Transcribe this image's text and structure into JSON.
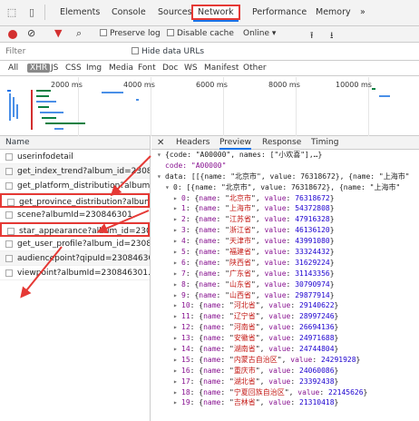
{
  "tabs": [
    "Elements",
    "Console",
    "Sources",
    "Network",
    "Performance",
    "Memory",
    "»"
  ],
  "active_tab": "Network",
  "toolbar": {
    "preserve_log": "Preserve log",
    "disable_cache": "Disable cache",
    "throttle": "Online"
  },
  "filter": {
    "placeholder": "Filter",
    "hide_data_urls": "Hide data URLs"
  },
  "types": [
    "All",
    "XHR",
    "JS",
    "CSS",
    "Img",
    "Media",
    "Font",
    "Doc",
    "WS",
    "Manifest",
    "Other"
  ],
  "active_type": "XHR",
  "overview_ticks": [
    "2000 ms",
    "4000 ms",
    "6000 ms",
    "8000 ms",
    "10000 ms"
  ],
  "requests_header": "Name",
  "requests": [
    "userinfodetail",
    "get_index_trend?album_id=2308...",
    "get_platform_distribution?album...",
    "get_province_distribution?album...",
    "scene?albumId=230846301",
    "star_appearance?album_id=2308...",
    "get_user_profile?album_id=2308...",
    "audiencepoint?qipuId=230846301",
    "viewpoint?albumId=230846301..."
  ],
  "highlighted_requests": [
    3,
    5
  ],
  "detail_tabs": [
    "Headers",
    "Preview",
    "Response",
    "Timing"
  ],
  "active_detail_tab": "Preview",
  "preview": {
    "root": "{code: \"A00000\", names: [\"小欢喜\"],…}",
    "code_line": "code: \"A00000\"",
    "data_line": "data: [[{name: \"北京市\", value: 76318672}, {name: \"上海市\"",
    "first_line": "0: [{name: \"北京市\", value: 76318672}, {name: \"上海市\"",
    "items": [
      {
        "index": "0",
        "name": "北京市",
        "value": "76318672"
      },
      {
        "index": "1",
        "name": "上海市",
        "value": "54372808"
      },
      {
        "index": "2",
        "name": "江苏省",
        "value": "47916328"
      },
      {
        "index": "3",
        "name": "浙江省",
        "value": "46136120"
      },
      {
        "index": "4",
        "name": "天津市",
        "value": "43991080"
      },
      {
        "index": "5",
        "name": "福建省",
        "value": "33324432"
      },
      {
        "index": "6",
        "name": "陕西省",
        "value": "31629224"
      },
      {
        "index": "7",
        "name": "广东省",
        "value": "31143356"
      },
      {
        "index": "8",
        "name": "山东省",
        "value": "30790974"
      },
      {
        "index": "9",
        "name": "山西省",
        "value": "29877914"
      },
      {
        "index": "10",
        "name": "河北省",
        "value": "29140622"
      },
      {
        "index": "11",
        "name": "辽宁省",
        "value": "28997246"
      },
      {
        "index": "12",
        "name": "河南省",
        "value": "26694136"
      },
      {
        "index": "13",
        "name": "安徽省",
        "value": "24971688"
      },
      {
        "index": "14",
        "name": "湖南省",
        "value": "24744804"
      },
      {
        "index": "15",
        "name": "内蒙古自治区",
        "value": "24291928"
      },
      {
        "index": "16",
        "name": "重庆市",
        "value": "24060086"
      },
      {
        "index": "17",
        "name": "湖北省",
        "value": "23392438"
      },
      {
        "index": "18",
        "name": "宁夏回族自治区",
        "value": "22145626"
      },
      {
        "index": "19",
        "name": "吉林省",
        "value": "21310418"
      }
    ]
  },
  "colors": {
    "highlight": "#e53935",
    "accent": "#1a73e8",
    "record": "#d32f2f"
  }
}
